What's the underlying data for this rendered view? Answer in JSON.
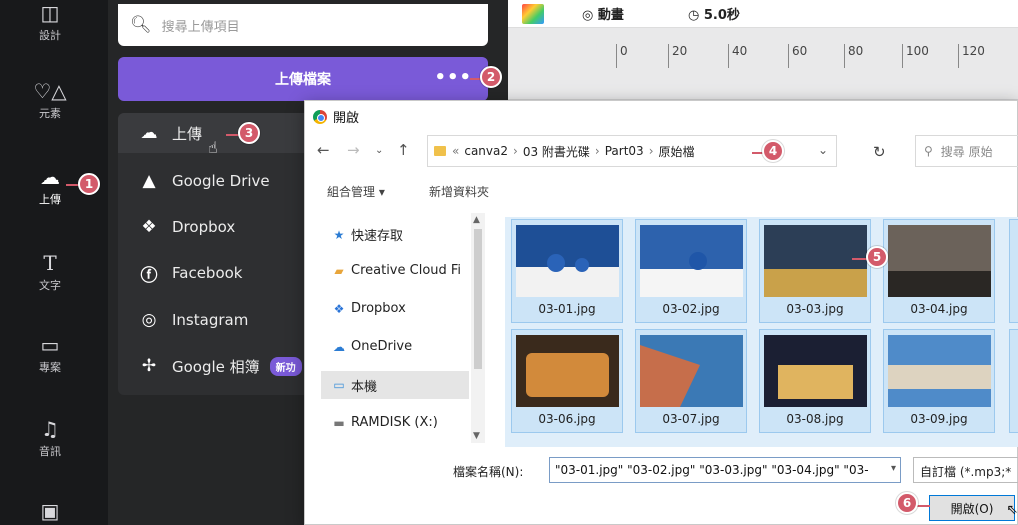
{
  "rail": {
    "items": [
      {
        "label": "設計",
        "icon": "layout-icon"
      },
      {
        "label": "元素",
        "icon": "shapes-icon"
      },
      {
        "label": "上傳",
        "icon": "cloud-upload-icon"
      },
      {
        "label": "文字",
        "icon": "text-icon"
      },
      {
        "label": "專案",
        "icon": "folder-icon"
      },
      {
        "label": "音訊",
        "icon": "music-icon"
      },
      {
        "label": "",
        "icon": "video-icon"
      }
    ]
  },
  "panel": {
    "search_placeholder": "搜尋上傳項目",
    "upload_button": "上傳檔案",
    "more": "•••",
    "menu": [
      {
        "label": "上傳",
        "icon": "cloud-upload-icon"
      },
      {
        "label": "Google Drive",
        "icon": "google-drive-icon"
      },
      {
        "label": "Dropbox",
        "icon": "dropbox-icon"
      },
      {
        "label": "Facebook",
        "icon": "facebook-icon"
      },
      {
        "label": "Instagram",
        "icon": "instagram-icon"
      },
      {
        "label": "Google 相簿",
        "icon": "google-photos-icon",
        "badge": "新功"
      }
    ]
  },
  "editor": {
    "animate": "動畫",
    "duration": "5.0秒",
    "ruler": [
      "0",
      "20",
      "40",
      "60",
      "80",
      "100",
      "120"
    ]
  },
  "dialog": {
    "title": "開啟",
    "breadcrumb": [
      "canva2",
      "03 附書光碟",
      "Part03",
      "原始檔"
    ],
    "search_placeholder": "搜尋 原始",
    "organize": "組合管理 ▾",
    "new_folder": "新增資料夾",
    "nav": [
      {
        "label": "快速存取",
        "icon": "star-icon"
      },
      {
        "label": "Creative Cloud Fi",
        "icon": "creative-cloud-icon"
      },
      {
        "label": "Dropbox",
        "icon": "dropbox-icon"
      },
      {
        "label": "OneDrive",
        "icon": "onedrive-icon"
      },
      {
        "label": "本機",
        "icon": "computer-icon"
      },
      {
        "label": "RAMDISK (X:)",
        "icon": "drive-icon"
      }
    ],
    "files": [
      {
        "name": "03-01.jpg",
        "colors": [
          "#1e4f96",
          "#f2f2f2"
        ]
      },
      {
        "name": "03-02.jpg",
        "colors": [
          "#2d62ad",
          "#f5f5f5"
        ]
      },
      {
        "name": "03-03.jpg",
        "colors": [
          "#2c3e56",
          "#c9a14a"
        ]
      },
      {
        "name": "03-04.jpg",
        "colors": [
          "#6b625a",
          "#2a2724"
        ]
      },
      {
        "name": "03-06.jpg",
        "colors": [
          "#3a2a1c",
          "#d28a3b"
        ]
      },
      {
        "name": "03-07.jpg",
        "colors": [
          "#3b79b5",
          "#c66e4b"
        ]
      },
      {
        "name": "03-08.jpg",
        "colors": [
          "#1b1f33",
          "#e0b45f"
        ]
      },
      {
        "name": "03-09.jpg",
        "colors": [
          "#4f8bc9",
          "#ddd3c0"
        ]
      }
    ],
    "filename_label": "檔案名稱(N):",
    "filename_value": "\"03-01.jpg\" \"03-02.jpg\" \"03-03.jpg\" \"03-04.jpg\" \"03-",
    "filter": "自訂檔 (*.mp3;*",
    "open_button": "開啟(O)"
  },
  "callouts": [
    "1",
    "2",
    "3",
    "4",
    "5",
    "6"
  ],
  "colors": {
    "accent": "#7a5ad8",
    "callout": "#d35a6a",
    "rail": "#18191b",
    "panel": "#252627"
  }
}
